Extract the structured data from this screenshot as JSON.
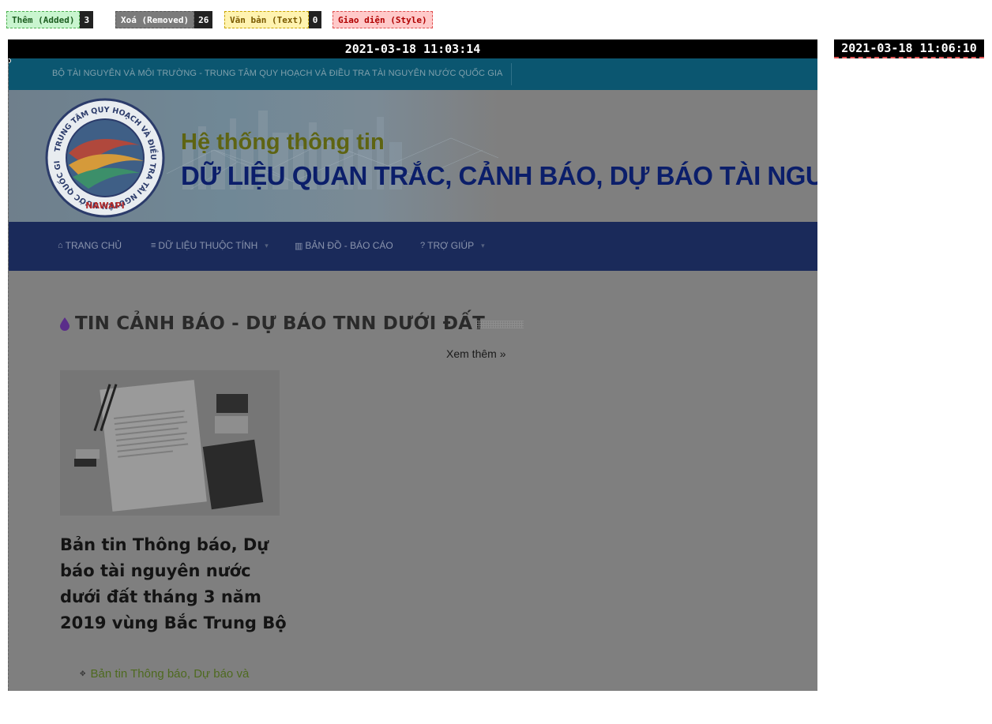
{
  "legend": [
    {
      "label": "Thêm (Added)",
      "count": "3",
      "color": "#c9f5cf"
    },
    {
      "label": "Xoá (Removed)",
      "count": "26",
      "color": "#7b7b7b"
    },
    {
      "label": "Văn bản (Text)",
      "count": "0",
      "color": "#fff3b0"
    },
    {
      "label": "Giao diện (Style)",
      "count": "",
      "color": "#ffc9c9"
    }
  ],
  "timestamps": {
    "left": "2021-03-18 11:03:14",
    "right": "2021-03-18 11:06:10"
  },
  "site": {
    "topbar_text": "BỘ TÀI NGUYÊN VÀ MÔI TRƯỜNG - TRUNG TÂM QUY HOẠCH VÀ ĐIỀU TRA TÀI NGUYÊN NƯỚC QUỐC GIA",
    "logo": {
      "ring_text": "TRUNG TÂM QUY HOẠCH VÀ ĐIỀU TRA TÀI NGUYÊN NƯỚC QUỐC GIA",
      "brand": "NAWAPI"
    },
    "title_line1": "Hệ thống thông tin",
    "title_line2": "DỮ LIỆU QUAN TRẮC, CẢNH BÁO, DỰ BÁO TÀI NGUY",
    "nav": [
      {
        "label": "TRANG CHỦ",
        "icon": "home-icon",
        "has_caret": false
      },
      {
        "label": "DỮ LIỆU THUỘC TÍNH",
        "icon": "database-icon",
        "has_caret": true
      },
      {
        "label": "BẢN ĐỒ - BÁO CÁO",
        "icon": "map-icon",
        "has_caret": false
      },
      {
        "label": "TRỢ GIÚP",
        "icon": "help-icon",
        "has_caret": true
      }
    ]
  },
  "content": {
    "section_title": "TIN CẢNH BÁO - DỰ BÁO TNN DƯỚI ĐẤT",
    "see_more": "Xem thêm »",
    "article_title": "Bản tin Thông báo, Dự báo tài nguyên nước dưới đất tháng 3 năm 2019 vùng Bắc Trung Bộ",
    "related_link": "Bản tin Thông báo, Dự báo và"
  },
  "colors": {
    "overlay_gray": "#7f7f7f",
    "topbar": "#0b5670",
    "navbar": "#1a2a5a",
    "title_line1": "#5e6412",
    "title_line2": "#0b1e6a",
    "related_link": "#4e6a1f"
  }
}
